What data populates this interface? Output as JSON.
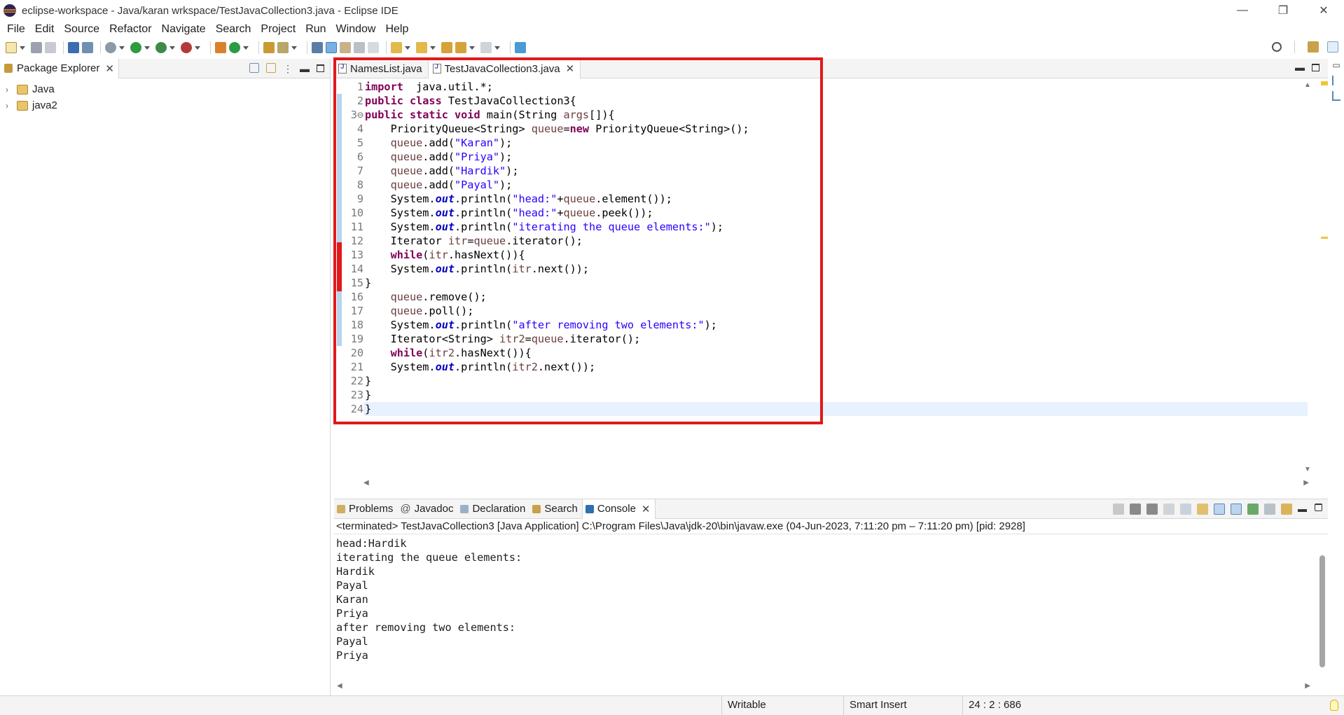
{
  "window": {
    "title": "eclipse-workspace - Java/karan wrkspace/TestJavaCollection3.java - Eclipse IDE",
    "controls": [
      "—",
      "❐",
      "✕"
    ]
  },
  "menu": [
    "File",
    "Edit",
    "Source",
    "Refactor",
    "Navigate",
    "Search",
    "Project",
    "Run",
    "Window",
    "Help"
  ],
  "package_explorer": {
    "tab_label": "Package Explorer",
    "items": [
      {
        "label": "Java"
      },
      {
        "label": "java2"
      }
    ]
  },
  "editor": {
    "tabs": [
      {
        "label": "NamesList.java",
        "active": false
      },
      {
        "label": "TestJavaCollection3.java",
        "active": true
      }
    ],
    "lines": [
      {
        "n": "1",
        "tokens": [
          [
            "kw",
            "import"
          ],
          [
            "",
            "  java.util.*;"
          ]
        ]
      },
      {
        "n": "2",
        "tokens": [
          [
            "kw",
            "public class"
          ],
          [
            "",
            " TestJavaCollection3{"
          ]
        ]
      },
      {
        "n": "3⊖",
        "tokens": [
          [
            "kw",
            "public static void"
          ],
          [
            "",
            " main(String "
          ],
          [
            "var",
            "args"
          ],
          [
            "",
            "[]){"
          ]
        ]
      },
      {
        "n": "4",
        "tokens": [
          [
            "",
            "    PriorityQueue<String> "
          ],
          [
            "var",
            "queue"
          ],
          [
            "",
            "="
          ],
          [
            "kw",
            "new"
          ],
          [
            "",
            " PriorityQueue<String>();"
          ]
        ]
      },
      {
        "n": "5",
        "tokens": [
          [
            "var",
            "    queue"
          ],
          [
            "",
            ".add("
          ],
          [
            "str",
            "\"Karan\""
          ],
          [
            "",
            ");"
          ]
        ]
      },
      {
        "n": "6",
        "tokens": [
          [
            "var",
            "    queue"
          ],
          [
            "",
            ".add("
          ],
          [
            "str",
            "\"Priya\""
          ],
          [
            "",
            ");"
          ]
        ]
      },
      {
        "n": "7",
        "tokens": [
          [
            "var",
            "    queue"
          ],
          [
            "",
            ".add("
          ],
          [
            "str",
            "\"Hardik\""
          ],
          [
            "",
            ");"
          ]
        ]
      },
      {
        "n": "8",
        "tokens": [
          [
            "var",
            "    queue"
          ],
          [
            "",
            ".add("
          ],
          [
            "str",
            "\"Payal\""
          ],
          [
            "",
            ");"
          ]
        ]
      },
      {
        "n": "9",
        "tokens": [
          [
            "",
            "    System."
          ],
          [
            "fld",
            "out"
          ],
          [
            "",
            ".println("
          ],
          [
            "str",
            "\"head:\""
          ],
          [
            "",
            "+"
          ],
          [
            "var",
            "queue"
          ],
          [
            "",
            ".element());"
          ]
        ]
      },
      {
        "n": "10",
        "tokens": [
          [
            "",
            "    System."
          ],
          [
            "fld",
            "out"
          ],
          [
            "",
            ".println("
          ],
          [
            "str",
            "\"head:\""
          ],
          [
            "",
            "+"
          ],
          [
            "var",
            "queue"
          ],
          [
            "",
            ".peek());"
          ]
        ]
      },
      {
        "n": "11",
        "tokens": [
          [
            "",
            "    System."
          ],
          [
            "fld",
            "out"
          ],
          [
            "",
            ".println("
          ],
          [
            "str",
            "\"iterating the queue elements:\""
          ],
          [
            "",
            ");"
          ]
        ]
      },
      {
        "n": "12",
        "tokens": [
          [
            "",
            "    Iterator "
          ],
          [
            "var",
            "itr"
          ],
          [
            "",
            "="
          ],
          [
            "var",
            "queue"
          ],
          [
            "",
            ".iterator();"
          ]
        ]
      },
      {
        "n": "13",
        "tokens": [
          [
            "",
            "    "
          ],
          [
            "kw",
            "while"
          ],
          [
            "",
            "("
          ],
          [
            "var",
            "itr"
          ],
          [
            "",
            ".hasNext()){"
          ]
        ]
      },
      {
        "n": "14",
        "tokens": [
          [
            "",
            "    System."
          ],
          [
            "fld",
            "out"
          ],
          [
            "",
            ".println("
          ],
          [
            "var",
            "itr"
          ],
          [
            "",
            ".next());"
          ]
        ]
      },
      {
        "n": "15",
        "tokens": [
          [
            "",
            "}"
          ]
        ]
      },
      {
        "n": "16",
        "tokens": [
          [
            "var",
            "    queue"
          ],
          [
            "",
            ".remove();"
          ]
        ]
      },
      {
        "n": "17",
        "tokens": [
          [
            "var",
            "    queue"
          ],
          [
            "",
            ".poll();"
          ]
        ]
      },
      {
        "n": "18",
        "tokens": [
          [
            "",
            "    System."
          ],
          [
            "fld",
            "out"
          ],
          [
            "",
            ".println("
          ],
          [
            "str",
            "\"after removing two elements:\""
          ],
          [
            "",
            ");"
          ]
        ]
      },
      {
        "n": "19",
        "tokens": [
          [
            "",
            "    Iterator<String> "
          ],
          [
            "var",
            "itr2"
          ],
          [
            "",
            "="
          ],
          [
            "var",
            "queue"
          ],
          [
            "",
            ".iterator();"
          ]
        ]
      },
      {
        "n": "20",
        "tokens": [
          [
            "",
            "    "
          ],
          [
            "kw",
            "while"
          ],
          [
            "",
            "("
          ],
          [
            "var",
            "itr2"
          ],
          [
            "",
            ".hasNext()){"
          ]
        ]
      },
      {
        "n": "21",
        "tokens": [
          [
            "",
            "    System."
          ],
          [
            "fld",
            "out"
          ],
          [
            "",
            ".println("
          ],
          [
            "var",
            "itr2"
          ],
          [
            "",
            ".next());"
          ]
        ]
      },
      {
        "n": "22",
        "tokens": [
          [
            "",
            "}"
          ]
        ]
      },
      {
        "n": "23",
        "tokens": [
          [
            "",
            "}"
          ]
        ]
      },
      {
        "n": "24",
        "tokens": [
          [
            "",
            "}"
          ]
        ]
      }
    ],
    "current_line": "24"
  },
  "console": {
    "tabs": [
      {
        "label": "Problems",
        "icon": "problems-icon",
        "active": false
      },
      {
        "label": "Javadoc",
        "icon": "javadoc-icon",
        "active": false
      },
      {
        "label": "Declaration",
        "icon": "declaration-icon",
        "active": false
      },
      {
        "label": "Search",
        "icon": "search-icon",
        "active": false
      },
      {
        "label": "Console",
        "icon": "console-icon",
        "active": true
      }
    ],
    "terminated_line": "<terminated> TestJavaCollection3 [Java Application] C:\\Program Files\\Java\\jdk-20\\bin\\javaw.exe  (04-Jun-2023, 7:11:20 pm – 7:11:20 pm) [pid: 2928]",
    "output": [
      "head:Hardik",
      "iterating the queue elements:",
      "Hardik",
      "Payal",
      "Karan",
      "Priya",
      "after removing two elements:",
      "Payal",
      "Priya"
    ]
  },
  "status": {
    "mode": "Writable",
    "insert": "Smart Insert",
    "position": "24 : 2 : 686"
  },
  "colors": {
    "keyword": "#7f0055",
    "string": "#2a00ff",
    "field": "#0000c0",
    "variable": "#6a3e3e",
    "highlight_box": "#e0191b"
  }
}
